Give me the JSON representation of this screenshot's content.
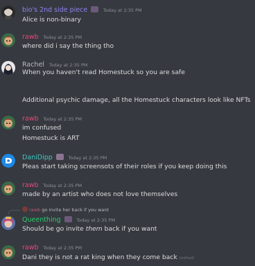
{
  "colors": {
    "background": "#36393f",
    "text": "#dcddde",
    "timestamp": "#8e9297",
    "name_purple": "#8e83f0",
    "name_pink": "#e4497a",
    "name_gray": "#b9bbbe",
    "name_teal": "#43c7c4",
    "name_green": "#2ecc71"
  },
  "messages": [
    {
      "author": "bio's 2nd side piece",
      "timestamp": "Today at 2:35 PM",
      "lines": [
        "Alice is non-binary"
      ]
    },
    {
      "author": "rawb",
      "timestamp": "Today at 2:35 PM",
      "lines": [
        "where did i say the thing tho"
      ]
    },
    {
      "author": "Rachel",
      "timestamp": "Today at 2:35 PM",
      "lines": [
        "When you haven't read Homestuck so you are safe",
        "Additional psychic damage, all the Homestuck characters look like NFTs"
      ]
    },
    {
      "author": "rawb",
      "timestamp": "Today at 2:35 PM",
      "lines": [
        "im confused",
        "Homestuck is ART"
      ]
    },
    {
      "author": "DaniDipp",
      "timestamp": "Today at 2:35 PM",
      "lines": [
        "Pleas start taking screensots of their roles if you keep doing this"
      ]
    },
    {
      "author": "rawb",
      "timestamp": "Today at 2:35 PM",
      "lines": [
        "made by an artist who does not love themselves"
      ]
    },
    {
      "reply_author": "rawb",
      "reply_text": "go invite her back if you want",
      "author": "Queenthing",
      "timestamp": "Today at 2:35 PM",
      "line_before": "Should be go invite ",
      "line_italic": "them",
      "line_after": " back if you want"
    },
    {
      "author": "rawb",
      "timestamp": "Today at 2:35 PM",
      "lines": [
        "Dani they is not a rat king when they come back"
      ],
      "edited": "(edited)"
    }
  ]
}
